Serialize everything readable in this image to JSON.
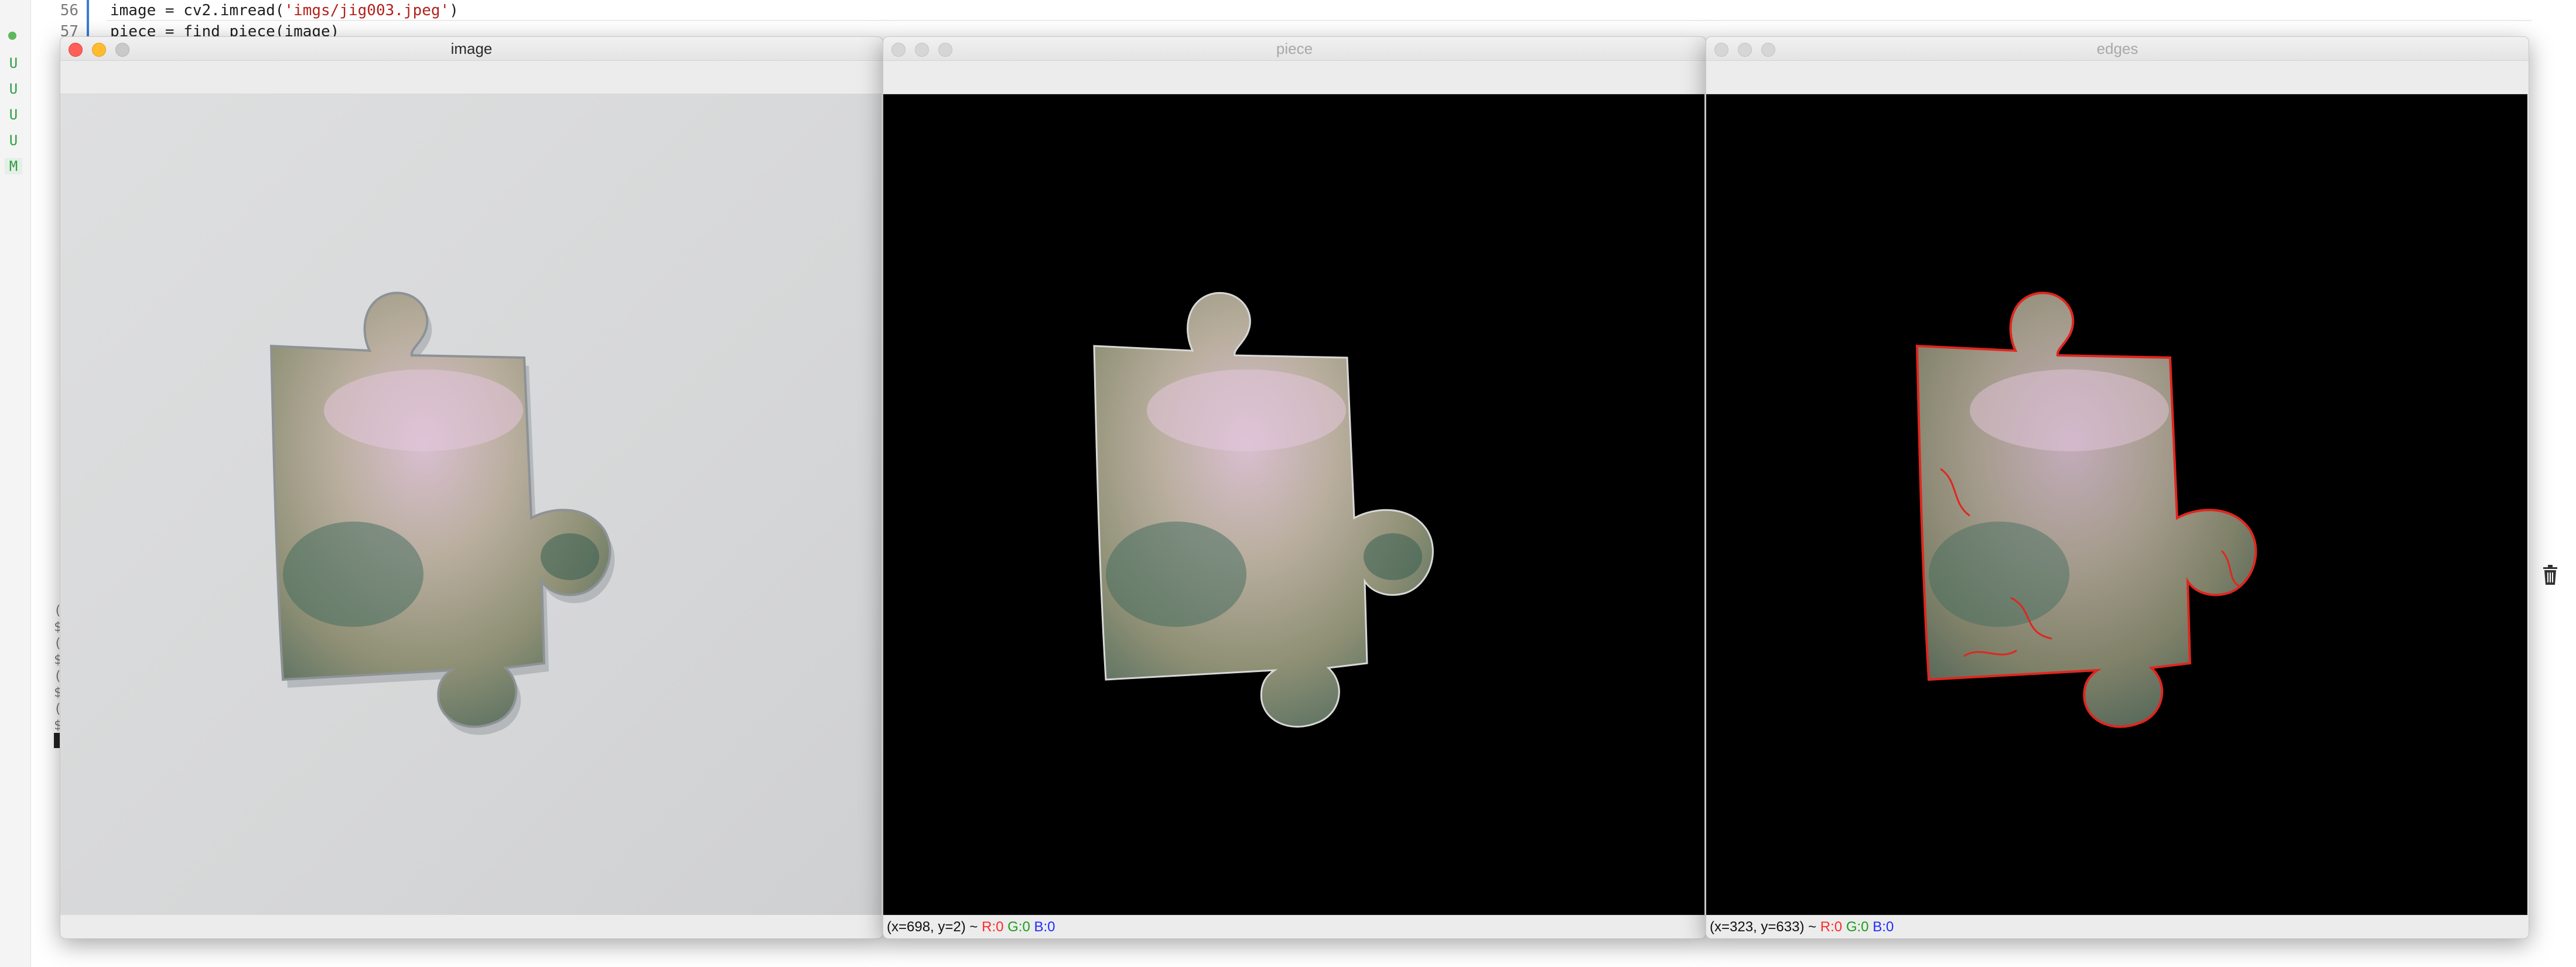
{
  "editor": {
    "git_markers": [
      "U",
      "U",
      "U",
      "U",
      "M"
    ],
    "code_lines": [
      {
        "number": "56",
        "before": "image = cv2.imread(",
        "string": "'imgs/jig003.jpeg'",
        "after": ")"
      },
      {
        "number": "57",
        "before": "piece = find_piece(image)",
        "string": "",
        "after": ""
      }
    ],
    "terminal_lines": [
      "(",
      "$",
      "(",
      "$",
      "(",
      "$",
      "(",
      "$"
    ]
  },
  "windows": [
    {
      "title": "image",
      "state": "active",
      "status": null
    },
    {
      "title": "piece",
      "state": "inactive",
      "status": {
        "coords": "(x=698, y=2) ~",
        "r": "R:0",
        "g": "G:0",
        "b": "B:0"
      }
    },
    {
      "title": "edges",
      "state": "inactive",
      "status": {
        "coords": "(x=323, y=633) ~",
        "r": "R:0",
        "g": "G:0",
        "b": "B:0"
      }
    }
  ],
  "colors": {
    "close": "#fe5f57",
    "minimize": "#febc2e",
    "edge_outline": "#e0261f",
    "image_background": "#d8d9da",
    "mask_background": "#000000"
  },
  "icons": {
    "trash": "trash-icon"
  }
}
